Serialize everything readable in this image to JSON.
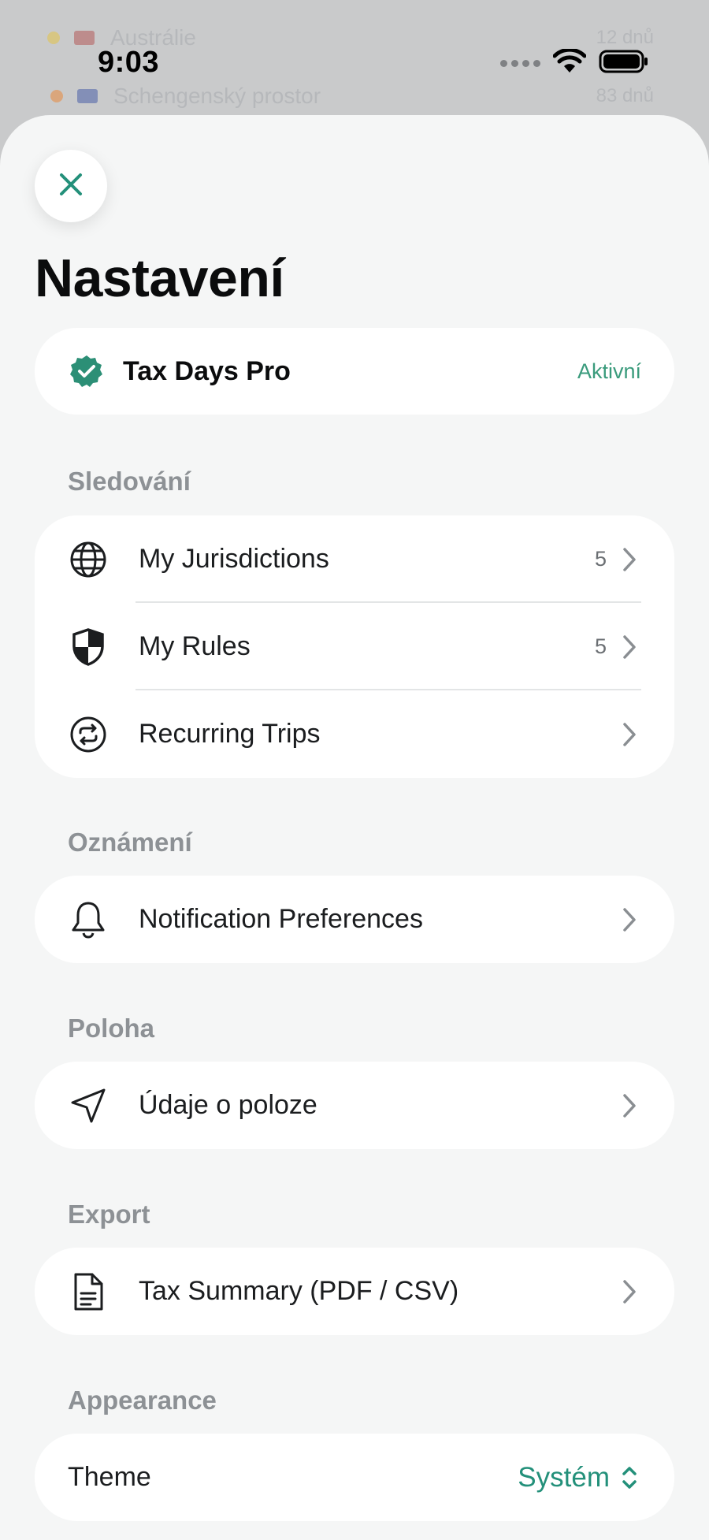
{
  "background": {
    "rows": [
      {
        "name": "Austrálie",
        "value": "12 dnů"
      },
      {
        "name": "Schengenský prostor",
        "value": "83 dnů"
      }
    ]
  },
  "status_bar": {
    "time": "9:03"
  },
  "sheet": {
    "title": "Nastavení",
    "pro": {
      "label": "Tax Days Pro",
      "status": "Aktivní"
    },
    "sections": {
      "tracking": {
        "header": "Sledování",
        "items": [
          {
            "label": "My Jurisdictions",
            "count": "5",
            "icon": "globe-icon"
          },
          {
            "label": "My Rules",
            "count": "5",
            "icon": "shield-icon"
          },
          {
            "label": "Recurring Trips",
            "icon": "recurring-icon"
          }
        ]
      },
      "notifications": {
        "header": "Oznámení",
        "items": [
          {
            "label": "Notification Preferences",
            "icon": "bell-icon"
          }
        ]
      },
      "location": {
        "header": "Poloha",
        "items": [
          {
            "label": "Údaje o poloze",
            "icon": "location-arrow-icon"
          }
        ]
      },
      "export": {
        "header": "Export",
        "items": [
          {
            "label": "Tax Summary (PDF / CSV)",
            "icon": "document-icon"
          }
        ]
      },
      "appearance": {
        "header": "Appearance",
        "theme": {
          "label": "Theme",
          "value": "Systém"
        }
      }
    }
  },
  "colors": {
    "accent": "#23907a",
    "pro_status": "#3a9b7c",
    "sheet_background": "#f5f6f6",
    "card_background": "#ffffff",
    "section_header": "#8d9195"
  }
}
